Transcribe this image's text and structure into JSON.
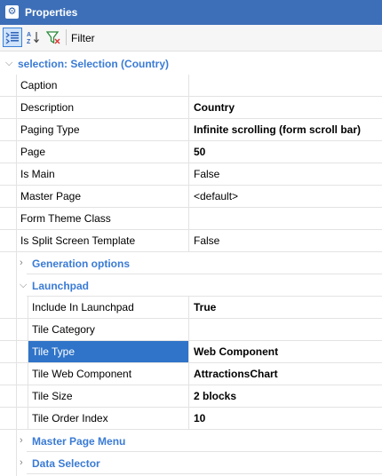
{
  "window": {
    "title": "Properties"
  },
  "toolbar": {
    "filter_label": "Filter"
  },
  "object_header": "selection: Selection (Country)",
  "properties": [
    {
      "name": "Caption",
      "value": "",
      "bold": false
    },
    {
      "name": "Description",
      "value": "Country",
      "bold": true
    },
    {
      "name": "Paging Type",
      "value": "Infinite scrolling (form scroll bar)",
      "bold": true
    },
    {
      "name": "Page",
      "value": "50",
      "bold": true
    },
    {
      "name": "Is Main",
      "value": "False",
      "bold": false
    },
    {
      "name": "Master Page",
      "value": "<default>",
      "bold": false
    },
    {
      "name": "Form Theme Class",
      "value": "",
      "bold": false
    },
    {
      "name": "Is Split Screen Template",
      "value": "False",
      "bold": false
    }
  ],
  "groups": {
    "generation_options": {
      "label": "Generation options",
      "expanded": false
    },
    "launchpad": {
      "label": "Launchpad",
      "expanded": true,
      "properties": [
        {
          "name": "Include In Launchpad",
          "value": "True",
          "bold": true
        },
        {
          "name": "Tile Category",
          "value": "",
          "bold": false
        },
        {
          "name": "Tile Type",
          "value": "Web Component",
          "bold": true,
          "selected": true
        },
        {
          "name": "Tile Web Component",
          "value": "AttractionsChart",
          "bold": true
        },
        {
          "name": "Tile Size",
          "value": "2 blocks",
          "bold": true
        },
        {
          "name": "Tile Order Index",
          "value": "10",
          "bold": true
        }
      ]
    },
    "master_page_menu": {
      "label": "Master Page Menu",
      "expanded": false
    },
    "data_selector": {
      "label": "Data Selector",
      "expanded": false
    }
  },
  "colors": {
    "title_bar": "#3d6fb8",
    "section_text": "#3a7bd5",
    "selection": "#2f74c9"
  },
  "icons": [
    "gear-icon",
    "categorized-view-icon",
    "sort-alpha-icon",
    "filter-funnel-icon",
    "chevron-down-icon",
    "chevron-right-icon"
  ]
}
